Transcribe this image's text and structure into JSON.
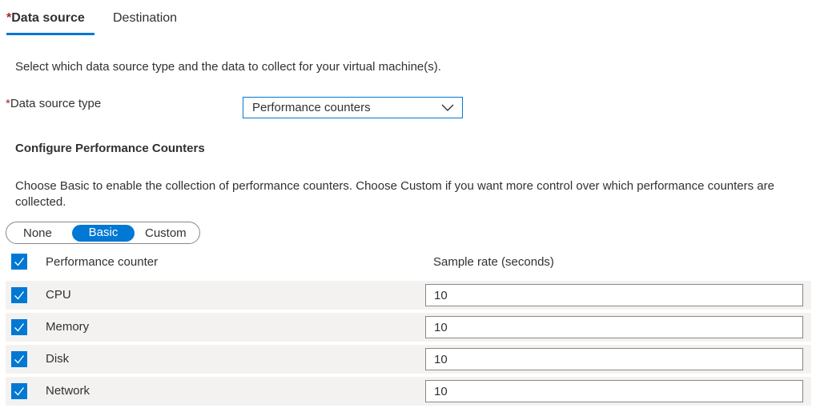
{
  "tabs": {
    "data_source": {
      "required": "*",
      "label": "Data source"
    },
    "destination": {
      "label": "Destination"
    }
  },
  "description": "Select which data source type and the data to collect for your virtual machine(s).",
  "data_source_type": {
    "required": "*",
    "label": "Data source type",
    "selected": "Performance counters"
  },
  "section_title": "Configure Performance Counters",
  "help_text": "Choose Basic to enable the collection of performance counters. Choose Custom if you want more control over which performance counters are collected.",
  "mode_toggle": {
    "options": [
      "None",
      "Basic",
      "Custom"
    ],
    "selected": "Basic"
  },
  "table": {
    "headers": {
      "counter": "Performance counter",
      "rate": "Sample rate (seconds)"
    },
    "rows": [
      {
        "name": "CPU",
        "rate": "10",
        "checked": true
      },
      {
        "name": "Memory",
        "rate": "10",
        "checked": true
      },
      {
        "name": "Disk",
        "rate": "10",
        "checked": true
      },
      {
        "name": "Network",
        "rate": "10",
        "checked": true
      }
    ]
  },
  "colors": {
    "accent": "#0078d4",
    "required": "#a4262c",
    "row_bg": "#f3f2f1"
  }
}
